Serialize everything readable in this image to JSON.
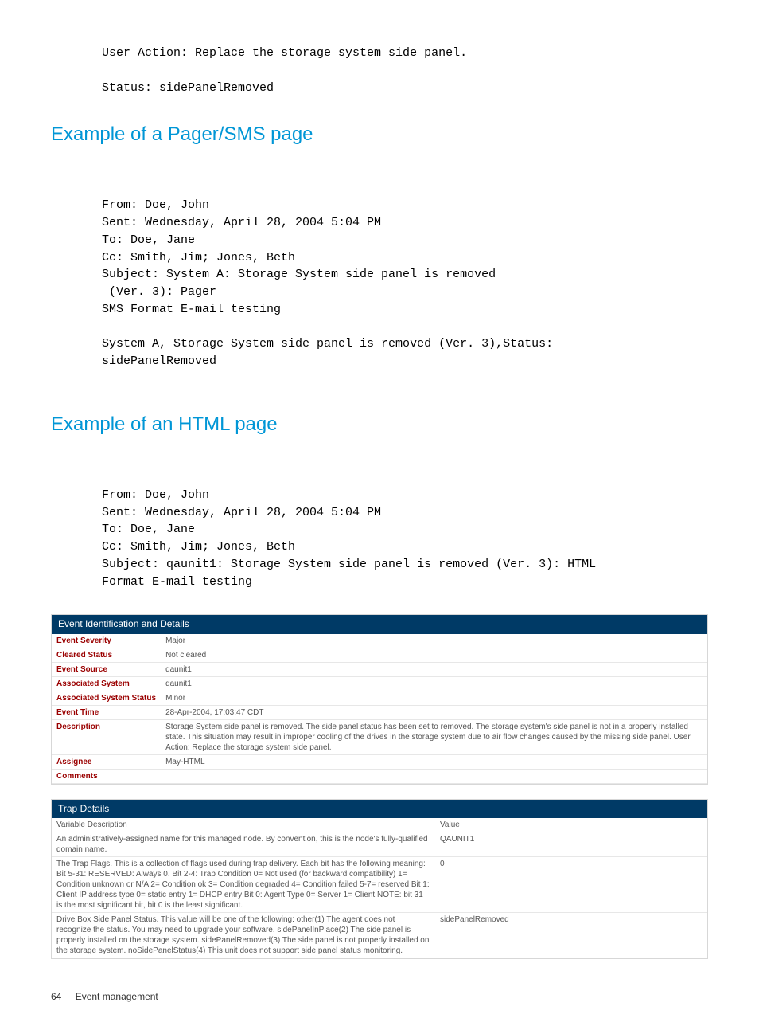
{
  "intro": {
    "userAction": "User Action: Replace the storage system side panel.",
    "status": "Status: sidePanelRemoved"
  },
  "sections": {
    "pager": {
      "heading": "Example of a Pager/SMS page",
      "lines": {
        "from": "From: Doe, John",
        "sent": "Sent: Wednesday, April 28, 2004 5:04 PM",
        "to": "To: Doe, Jane",
        "cc": "Cc: Smith, Jim; Jones, Beth",
        "subj1": "Subject: System A: Storage System side panel is removed",
        "subj2": " (Ver. 3): Pager",
        "fmt": "SMS Format E-mail testing",
        "body1": "System A, Storage System side panel is removed (Ver. 3),Status:",
        "body2": "sidePanelRemoved"
      }
    },
    "html": {
      "heading": "Example of an HTML page",
      "lines": {
        "from": "From: Doe, John",
        "sent": "Sent: Wednesday, April 28, 2004 5:04 PM",
        "to": "To: Doe, Jane",
        "cc": "Cc: Smith, Jim; Jones, Beth",
        "subj": "Subject: qaunit1: Storage System side panel is removed (Ver. 3): HTML",
        "fmt": "Format E-mail testing"
      }
    }
  },
  "eventPanel": {
    "title": "Event Identification and Details",
    "rows": [
      {
        "label": "Event Severity",
        "value": "Major"
      },
      {
        "label": "Cleared Status",
        "value": "Not cleared"
      },
      {
        "label": "Event Source",
        "value": "qaunit1"
      },
      {
        "label": "Associated System",
        "value": "qaunit1"
      },
      {
        "label": "Associated System Status",
        "value": "Minor"
      },
      {
        "label": "Event Time",
        "value": "28-Apr-2004, 17:03:47 CDT"
      },
      {
        "label": "Description",
        "value": "Storage System side panel is removed. The side panel status has been set to removed. The storage system's side panel is not in a properly installed state. This situation may result in improper cooling of the drives in the storage system due to air flow changes caused by the missing side panel. User Action: Replace the storage system side panel."
      },
      {
        "label": "Assignee",
        "value": "May-HTML"
      },
      {
        "label": "Comments",
        "value": ""
      }
    ]
  },
  "trapPanel": {
    "title": "Trap Details",
    "header": {
      "desc": "Variable Description",
      "val": "Value"
    },
    "rows": [
      {
        "desc": "An administratively-assigned name for this managed node. By convention, this is the node's fully-qualified domain name.",
        "val": "QAUNIT1"
      },
      {
        "desc": "The Trap Flags. This is a collection of flags used during trap delivery. Each bit has the following meaning: Bit 5-31: RESERVED: Always 0. Bit 2-4: Trap Condition 0= Not used (for backward compatibility) 1= Condition unknown or N/A 2= Condition ok 3= Condition degraded 4= Condition failed 5-7= reserved Bit 1: Client IP address type 0= static entry 1= DHCP entry Bit 0: Agent Type 0= Server 1= Client NOTE: bit 31 is the most significant bit, bit 0 is the least significant.",
        "val": "0"
      },
      {
        "desc": "Drive Box Side Panel Status. This value will be one of the following: other(1) The agent does not recognize the status. You may need to upgrade your software. sidePanelInPlace(2) The side panel is properly installed on the storage system. sidePanelRemoved(3) The side panel is not properly installed on the storage system. noSidePanelStatus(4) This unit does not support side panel status monitoring.",
        "val": "sidePanelRemoved"
      }
    ]
  },
  "footer": {
    "page": "64",
    "title": "Event management"
  }
}
